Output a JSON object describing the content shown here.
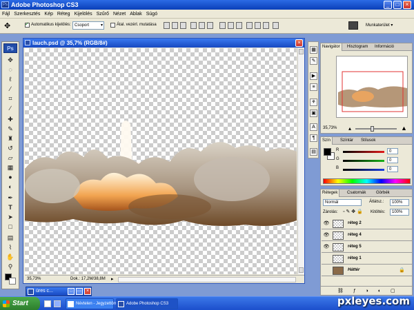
{
  "window": {
    "title": "Adobe Photoshop CS3",
    "app_icon": "Ps"
  },
  "window_buttons": {
    "minimize": "_",
    "maximize": "□",
    "close": "×"
  },
  "menu": [
    "Fájl",
    "Szerkesztés",
    "Kép",
    "Réteg",
    "Kijelölés",
    "Szűrő",
    "Nézet",
    "Ablak",
    "Súgó"
  ],
  "options": {
    "auto_select_label": "Automatikus kijelölés:",
    "auto_select_checked": true,
    "auto_select_value": "Csoport",
    "transform_label": "Átal. vezérl. mutatása",
    "transform_checked": false,
    "workspace_label": "Munkaterület"
  },
  "toolbox": {
    "logo": "Ps",
    "tools": [
      "move-icon",
      "marquee-icon",
      "lasso-icon",
      "magic-wand-icon",
      "crop-icon",
      "slice-icon",
      "healing-icon",
      "brush-icon",
      "clone-stamp-icon",
      "history-brush-icon",
      "eraser-icon",
      "gradient-icon",
      "blur-icon",
      "dodge-icon",
      "pen-icon",
      "type-icon",
      "path-select-icon",
      "shape-icon",
      "notes-icon",
      "eyedropper-icon",
      "hand-icon",
      "zoom-icon"
    ]
  },
  "document": {
    "title": "lauch.psd @ 35,7% (RGB/8#)",
    "zoom": "35,73%",
    "doc_size": "Dok.: 17,2M/38,8M"
  },
  "navigator": {
    "tabs": [
      "Navigátor",
      "Hisztogram",
      "Információ"
    ],
    "zoom": "35,73%",
    "zoom_level": 0.4
  },
  "color": {
    "tabs": [
      "Szín",
      "Színtár",
      "Stílusok"
    ],
    "channels": [
      {
        "label": "R",
        "value": "0",
        "color": "#e21b1b"
      },
      {
        "label": "G",
        "value": "0",
        "color": "#19b419"
      },
      {
        "label": "B",
        "value": "0",
        "color": "#1b3ee2"
      }
    ],
    "foreground": "#000000",
    "background": "#ffffff"
  },
  "layers": {
    "tabs": [
      "Rétegek",
      "Csatornák",
      "Görbék"
    ],
    "blend_mode": "Normál",
    "opacity_label": "Átlátsz.:",
    "opacity": "100%",
    "lock_label": "Zárolás:",
    "fill_label": "Kitöltés:",
    "fill": "100%",
    "items": [
      {
        "name": "réteg 2",
        "visible": true,
        "selected": true
      },
      {
        "name": "réteg 4",
        "visible": true,
        "selected": true
      },
      {
        "name": "réteg 5",
        "visible": true,
        "selected": true
      },
      {
        "name": "réteg 1",
        "visible": false,
        "selected": false
      },
      {
        "name": "Háttér",
        "visible": false,
        "selected": false,
        "locked": true
      }
    ]
  },
  "minimized": {
    "label": "üres c..."
  },
  "taskbar": {
    "start": "Start",
    "tasks": [
      {
        "label": "Névtelen - Jegyzettömb",
        "active": false
      },
      {
        "label": "Adobe Photoshop CS3",
        "active": true
      }
    ]
  },
  "watermark": "pxleyes.com"
}
